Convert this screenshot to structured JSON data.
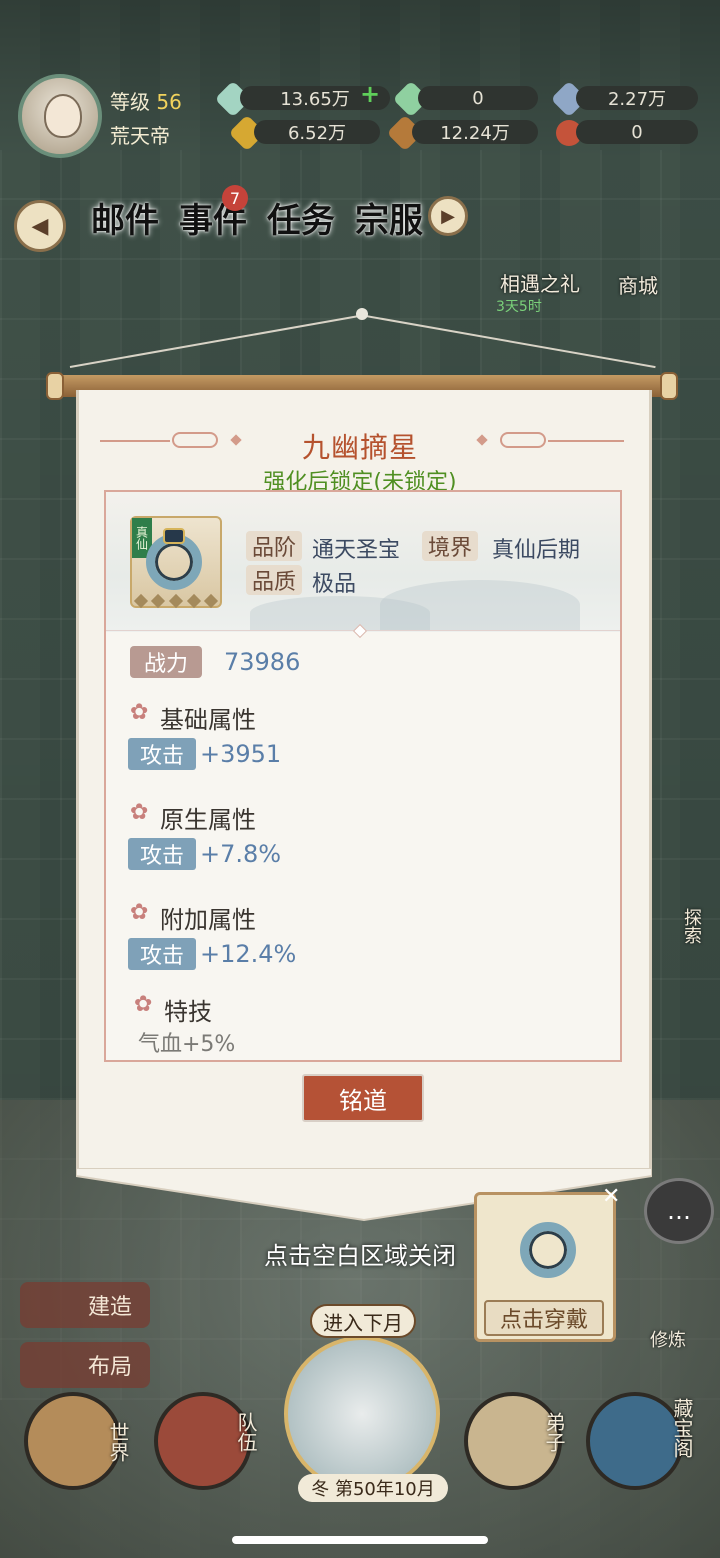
{
  "header": {
    "level_label": "等级",
    "level_value": "56",
    "player_name": "荒天帝",
    "resources": [
      {
        "id": "jade",
        "value": "13.65万",
        "color": "#a3d4c2"
      },
      {
        "id": "spirit-crystal",
        "value": "0",
        "color": "#8fd0a0"
      },
      {
        "id": "stone",
        "value": "2.27万",
        "color": "#8fa7c6"
      },
      {
        "id": "gold",
        "value": "6.52万",
        "color": "#d6a832"
      },
      {
        "id": "wood",
        "value": "12.24万",
        "color": "#b57a3a"
      },
      {
        "id": "medal",
        "value": "0",
        "color": "#c5533a"
      }
    ]
  },
  "nav": {
    "mail": "邮件",
    "events": "事件",
    "events_badge": "7",
    "tasks": "任务",
    "sect": "宗服",
    "gift_label": "相遇之礼",
    "gift_timer": "3天5时",
    "shop_label": "商城"
  },
  "dialog": {
    "title": "九幽摘星",
    "subtitle": "强化后锁定(未锁定)",
    "item_tag": "真仙",
    "grade_label": "品阶",
    "grade_value": "通天圣宝",
    "realm_label": "境界",
    "realm_value": "真仙后期",
    "quality_label": "品质",
    "quality_value": "极品",
    "power_label": "战力",
    "power_value": "73986",
    "sections": [
      {
        "title": "基础属性",
        "stat": "攻击",
        "value": "+3951"
      },
      {
        "title": "原生属性",
        "stat": "攻击",
        "value": "+7.8%"
      },
      {
        "title": "附加属性",
        "stat": "攻击",
        "value": "+12.4%"
      }
    ],
    "skill_title": "特技",
    "skill_text": "气血+5%",
    "inscribe_button": "铭道"
  },
  "close_hint": "点击空白区域关闭",
  "bottom": {
    "equip_button": "点击穿戴",
    "build": "建造",
    "layout": "布局",
    "next_month": "进入下月",
    "date": "第50年10月",
    "season": "冬",
    "world": "世界",
    "team": "队伍",
    "disciples": "弟子",
    "treasury": "藏宝阁",
    "cultivate": "修炼",
    "explore": "探索"
  }
}
